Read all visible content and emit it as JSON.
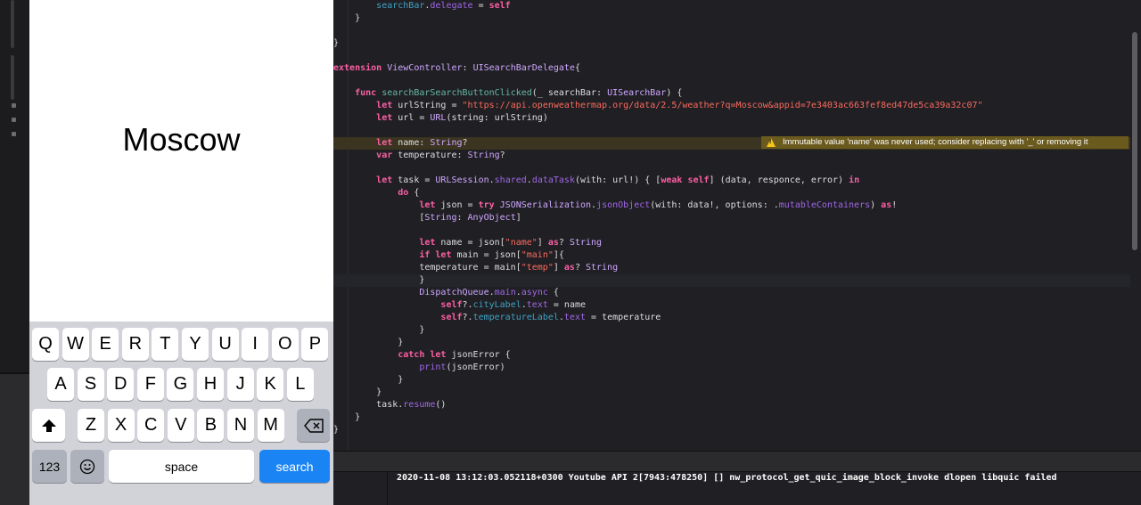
{
  "simulator": {
    "city_label": "Moscow",
    "keyboard": {
      "row1": [
        "Q",
        "W",
        "E",
        "R",
        "T",
        "Y",
        "U",
        "I",
        "O",
        "P"
      ],
      "row2": [
        "A",
        "S",
        "D",
        "F",
        "G",
        "H",
        "J",
        "K",
        "L"
      ],
      "row3": [
        "Z",
        "X",
        "C",
        "V",
        "B",
        "N",
        "M"
      ],
      "numbers_key": "123",
      "space_key": "space",
      "search_key": "search"
    }
  },
  "editor": {
    "lines": [
      {
        "segments": [
          [
            "        ",
            ""
          ],
          [
            "searchBar",
            "id"
          ],
          [
            ".",
            ""
          ],
          [
            "delegate",
            "pr"
          ],
          [
            " = ",
            ""
          ],
          [
            "self",
            "kw"
          ]
        ]
      },
      {
        "segments": [
          [
            "    }",
            ""
          ]
        ]
      },
      {
        "segments": [
          [
            "",
            ""
          ]
        ]
      },
      {
        "segments": [
          [
            "}",
            ""
          ]
        ]
      },
      {
        "segments": [
          [
            "",
            ""
          ]
        ]
      },
      {
        "segments": [
          [
            "extension",
            "kw"
          ],
          [
            " ",
            ""
          ],
          [
            "ViewController",
            "ty"
          ],
          [
            ": ",
            ""
          ],
          [
            "UISearchBarDelegate",
            "ty"
          ],
          [
            "{",
            ""
          ]
        ]
      },
      {
        "segments": [
          [
            "",
            ""
          ]
        ]
      },
      {
        "segments": [
          [
            "    ",
            ""
          ],
          [
            "func",
            "kw"
          ],
          [
            " ",
            ""
          ],
          [
            "searchBarSearchButtonClicked",
            "fn"
          ],
          [
            "(_ searchBar: ",
            ""
          ],
          [
            "UISearchBar",
            "ty"
          ],
          [
            ") {",
            ""
          ]
        ]
      },
      {
        "segments": [
          [
            "        ",
            ""
          ],
          [
            "let",
            "kw"
          ],
          [
            " urlString = ",
            ""
          ],
          [
            "\"https://api.openweathermap.org/data/2.5/weather?q=Moscow&appid=7e3403ac663fef8ed47de5ca39a32c07\"",
            "st"
          ]
        ]
      },
      {
        "segments": [
          [
            "        ",
            ""
          ],
          [
            "let",
            "kw"
          ],
          [
            " url = ",
            ""
          ],
          [
            "URL",
            "ty"
          ],
          [
            "(string: urlString)",
            ""
          ]
        ]
      },
      {
        "segments": [
          [
            "",
            ""
          ]
        ]
      },
      {
        "segments": [
          [
            "        ",
            ""
          ],
          [
            "let",
            "kw"
          ],
          [
            " name: ",
            ""
          ],
          [
            "String",
            "ty"
          ],
          [
            "?",
            ""
          ]
        ],
        "warn": true
      },
      {
        "segments": [
          [
            "        ",
            ""
          ],
          [
            "var",
            "kw"
          ],
          [
            " temperature: ",
            ""
          ],
          [
            "String",
            "ty"
          ],
          [
            "?",
            ""
          ]
        ]
      },
      {
        "segments": [
          [
            "",
            ""
          ]
        ]
      },
      {
        "segments": [
          [
            "        ",
            ""
          ],
          [
            "let",
            "kw"
          ],
          [
            " task = ",
            ""
          ],
          [
            "URLSession",
            "ty"
          ],
          [
            ".",
            ""
          ],
          [
            "shared",
            "pr"
          ],
          [
            ".",
            ""
          ],
          [
            "dataTask",
            "pr"
          ],
          [
            "(with: url!) { [",
            ""
          ],
          [
            "weak",
            "kw"
          ],
          [
            " ",
            ""
          ],
          [
            "self",
            "kw"
          ],
          [
            "] (data, responce, error) ",
            ""
          ],
          [
            "in",
            "kw"
          ]
        ]
      },
      {
        "segments": [
          [
            "            ",
            ""
          ],
          [
            "do",
            "kw"
          ],
          [
            " {",
            ""
          ]
        ]
      },
      {
        "segments": [
          [
            "                ",
            ""
          ],
          [
            "let",
            "kw"
          ],
          [
            " json = ",
            ""
          ],
          [
            "try",
            "kw"
          ],
          [
            " ",
            ""
          ],
          [
            "JSONSerialization",
            "ty"
          ],
          [
            ".",
            ""
          ],
          [
            "jsonObject",
            "pr"
          ],
          [
            "(with: data!, options: .",
            ""
          ],
          [
            "mutableContainers",
            "pr"
          ],
          [
            ") ",
            ""
          ],
          [
            "as",
            "kw"
          ],
          [
            "!",
            ""
          ]
        ]
      },
      {
        "segments": [
          [
            "                [",
            ""
          ],
          [
            "String",
            "ty"
          ],
          [
            ": ",
            ""
          ],
          [
            "AnyObject",
            "ty"
          ],
          [
            "]",
            ""
          ]
        ]
      },
      {
        "segments": [
          [
            "",
            ""
          ]
        ]
      },
      {
        "segments": [
          [
            "                ",
            ""
          ],
          [
            "let",
            "kw"
          ],
          [
            " name = json[",
            ""
          ],
          [
            "\"name\"",
            "st"
          ],
          [
            "] ",
            ""
          ],
          [
            "as",
            "kw"
          ],
          [
            "? ",
            ""
          ],
          [
            "String",
            "ty"
          ]
        ]
      },
      {
        "segments": [
          [
            "                ",
            ""
          ],
          [
            "if",
            "kw"
          ],
          [
            " ",
            ""
          ],
          [
            "let",
            "kw"
          ],
          [
            " main = json[",
            ""
          ],
          [
            "\"main\"",
            "st"
          ],
          [
            "]{",
            ""
          ]
        ]
      },
      {
        "segments": [
          [
            "                temperature = main[",
            ""
          ],
          [
            "\"temp\"",
            "st"
          ],
          [
            "] ",
            ""
          ],
          [
            "as",
            "kw"
          ],
          [
            "? ",
            ""
          ],
          [
            "String",
            "ty"
          ]
        ]
      },
      {
        "segments": [
          [
            "                }",
            ""
          ]
        ],
        "current": true
      },
      {
        "segments": [
          [
            "                ",
            ""
          ],
          [
            "DispatchQueue",
            "ty"
          ],
          [
            ".",
            ""
          ],
          [
            "main",
            "pr"
          ],
          [
            ".",
            ""
          ],
          [
            "async",
            "pr"
          ],
          [
            " {",
            ""
          ]
        ]
      },
      {
        "segments": [
          [
            "                    ",
            ""
          ],
          [
            "self",
            "kw"
          ],
          [
            "?.",
            ""
          ],
          [
            "cityLabel",
            "id"
          ],
          [
            ".",
            ""
          ],
          [
            "text",
            "pr"
          ],
          [
            " = name",
            ""
          ]
        ]
      },
      {
        "segments": [
          [
            "                    ",
            ""
          ],
          [
            "self",
            "kw"
          ],
          [
            "?.",
            ""
          ],
          [
            "temperatureLabel",
            "id"
          ],
          [
            ".",
            ""
          ],
          [
            "text",
            "pr"
          ],
          [
            " = temperature",
            ""
          ]
        ]
      },
      {
        "segments": [
          [
            "                }",
            ""
          ]
        ]
      },
      {
        "segments": [
          [
            "            }",
            ""
          ]
        ]
      },
      {
        "segments": [
          [
            "            ",
            ""
          ],
          [
            "catch",
            "kw"
          ],
          [
            " ",
            ""
          ],
          [
            "let",
            "kw"
          ],
          [
            " jsonError {",
            ""
          ]
        ]
      },
      {
        "segments": [
          [
            "                ",
            ""
          ],
          [
            "print",
            "pr"
          ],
          [
            "(jsonError)",
            ""
          ]
        ]
      },
      {
        "segments": [
          [
            "            }",
            ""
          ]
        ]
      },
      {
        "segments": [
          [
            "        }",
            ""
          ]
        ]
      },
      {
        "segments": [
          [
            "        task.",
            ""
          ],
          [
            "resume",
            "pr"
          ],
          [
            "()",
            ""
          ]
        ]
      },
      {
        "segments": [
          [
            "    }",
            ""
          ]
        ]
      },
      {
        "segments": [
          [
            "}",
            ""
          ]
        ]
      }
    ],
    "warning_text": "Immutable value 'name' was never used; consider replacing with '_' or removing it",
    "warning_icon": "warning-triangle-icon"
  },
  "console": {
    "log_line": "2020-11-08 13:12:03.052118+0300 Youtube API 2[7943:478250] [] nw_protocol_get_quic_image_block_invoke dlopen libquic failed"
  },
  "colors": {
    "keyword": "#fc5fa3",
    "type": "#d0a8ff",
    "string": "#fc6a5d",
    "property": "#a167e6",
    "function": "#67b7a4",
    "search_key": "#1b84f4",
    "warning_bg": "#6b5a1e"
  }
}
